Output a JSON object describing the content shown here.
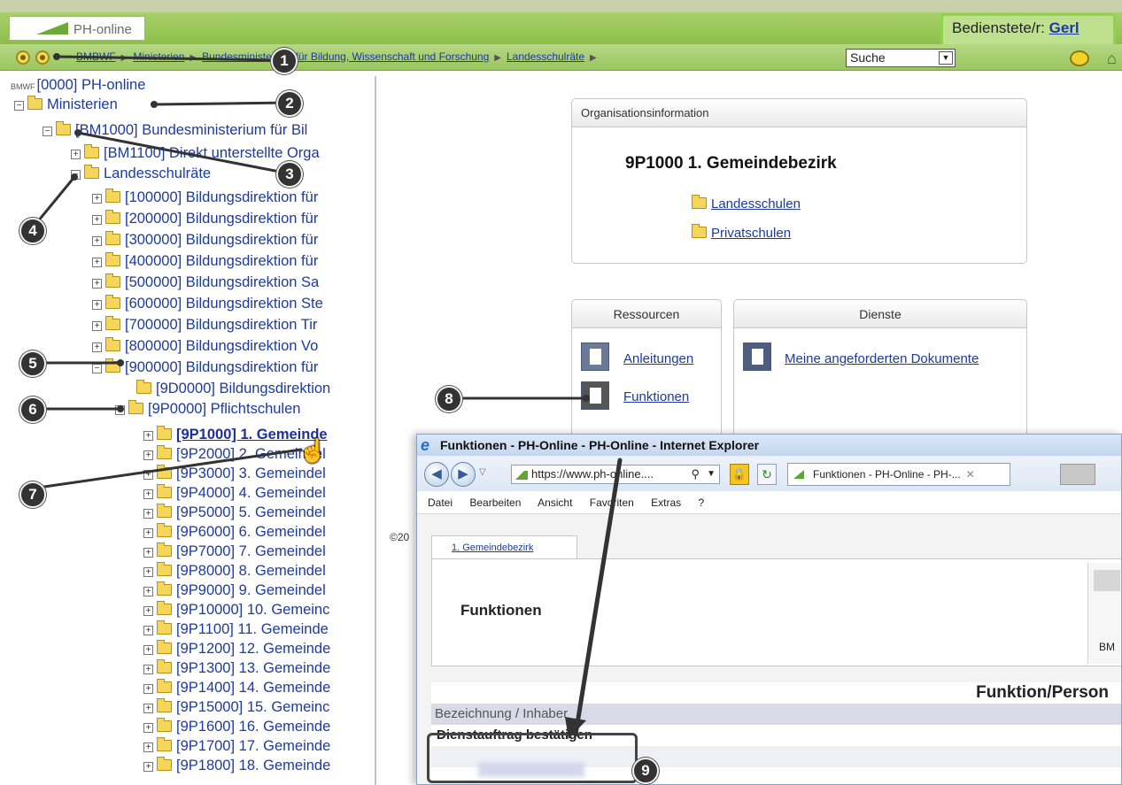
{
  "header": {
    "logo_text": "PH-online",
    "user_label": "Bedienstete/r:",
    "user_name": "Gerl"
  },
  "breadcrumb": {
    "items": [
      "BMBWF",
      "Ministerien",
      "Bundesministerium für Bildung, Wissenschaft und Forschung",
      "Landesschulräte"
    ]
  },
  "search": {
    "value": "Suche"
  },
  "tree": {
    "root_prefix": "BMWF",
    "root": "[0000] PH-online",
    "ministerien": "Ministerien",
    "bm1000": "[BM1000] Bundesministerium für Bil",
    "bm1100": "[BM1100] Direkt unterstellte Orga",
    "landesschulraete": "Landesschulräte",
    "direktionen": [
      "[100000] Bildungsdirektion für",
      "[200000] Bildungsdirektion für",
      "[300000] Bildungsdirektion für",
      "[400000] Bildungsdirektion für",
      "[500000] Bildungsdirektion Sa",
      "[600000] Bildungsdirektion Ste",
      "[700000] Bildungsdirektion Tir",
      "[800000] Bildungsdirektion Vo",
      "[900000] Bildungsdirektion für"
    ],
    "d9d0000": "[9D0000] Bildungsdirektion",
    "p9p0000": "[9P0000] Pflichtschulen",
    "bezirke": [
      "[9P1000] 1. Gemeinde",
      "[9P2000] 2. Gemeindel",
      "[9P3000] 3. Gemeindel",
      "[9P4000] 4. Gemeindel",
      "[9P5000] 5. Gemeindel",
      "[9P6000] 6. Gemeindel",
      "[9P7000] 7. Gemeindel",
      "[9P8000] 8. Gemeindel",
      "[9P9000] 9. Gemeindel",
      "[9P10000] 10. Gemeinc",
      "[9P1100] 11. Gemeinde",
      "[9P1200] 12. Gemeinde",
      "[9P1300] 13. Gemeinde",
      "[9P1400] 14. Gemeinde",
      "[9P15000] 15. Gemeinc",
      "[9P1600] 16. Gemeinde",
      "[9P1700] 17. Gemeinde",
      "[9P1800] 18. Gemeinde"
    ]
  },
  "copyright": "©20",
  "org": {
    "header": "Organisationsinformation",
    "title": "9P1000  1. Gemeindebezirk",
    "link1": "Landesschulen",
    "link2": "Privatschulen"
  },
  "ressourcen": {
    "header": "Ressourcen",
    "anleitungen": "Anleitungen",
    "funktionen": "Funktionen"
  },
  "dienste": {
    "header": "Dienste",
    "dokumente": "Meine angeforderten Dokumente"
  },
  "ie": {
    "title": "Funktionen - PH-Online - PH-Online - Internet Explorer",
    "address": "https://www.ph-online....",
    "tab_title": "Funktionen - PH-Online - PH-...",
    "menu": [
      "Datei",
      "Bearbeiten",
      "Ansicht",
      "Favoriten",
      "Extras",
      "?"
    ],
    "page_tab": "1. Gemeindebezirk",
    "page_title": "Funktionen",
    "side_label": "BM",
    "table_header": "Funktion/Person",
    "table_sub": "Bezeichnung / Inhaber",
    "row1": "Dienstauftrag bestätigen"
  },
  "callouts": [
    "1",
    "2",
    "3",
    "4",
    "5",
    "6",
    "7",
    "8",
    "9"
  ],
  "colors": {
    "green_bar": "#9ac660",
    "highlight_green": "#8dd44a",
    "link_blue": "#1c3aa0",
    "callout_dark": "#333333"
  }
}
